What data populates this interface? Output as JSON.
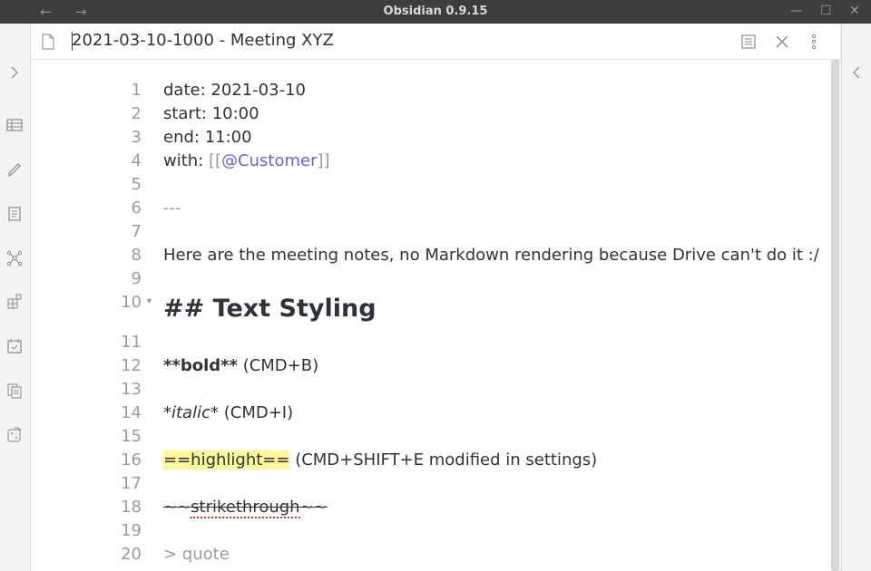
{
  "window": {
    "title": "Obsidian 0.9.15",
    "nav_back": "←",
    "nav_forward": "→",
    "minimize": "—",
    "maximize": "☐",
    "close": "✕"
  },
  "pane": {
    "title": "2021-03-10-1000 - Meeting XYZ"
  },
  "editor": {
    "lines": [
      {
        "num": "1",
        "text": "date: 2021-03-10"
      },
      {
        "num": "2",
        "text": "start: 10:00"
      },
      {
        "num": "3",
        "text": "end: 11:00"
      },
      {
        "num": "4",
        "prefix": "with: ",
        "bracket_open": "[[",
        "link": "@Customer",
        "bracket_close": "]]"
      },
      {
        "num": "5",
        "text": ""
      },
      {
        "num": "6",
        "text": "---"
      },
      {
        "num": "7",
        "text": ""
      },
      {
        "num": "8",
        "text": "Here are the meeting notes, no Markdown rendering because Drive can't do it :/"
      },
      {
        "num": "9",
        "text": ""
      },
      {
        "num": "10",
        "text": "## Text Styling",
        "fold": "▾"
      },
      {
        "num": "11",
        "text": ""
      },
      {
        "num": "12",
        "bold": "**bold**",
        "rest": " (CMD+B)"
      },
      {
        "num": "13",
        "text": ""
      },
      {
        "num": "14",
        "italic": "*italic*",
        "rest": " (CMD+I)"
      },
      {
        "num": "15",
        "text": ""
      },
      {
        "num": "16",
        "highlight": "==highlight==",
        "rest": " (CMD+SHIFT+E modified in settings)"
      },
      {
        "num": "17",
        "text": ""
      },
      {
        "num": "18",
        "strike_open": "~~",
        "strike_word": "strikethrough",
        "strike_close": "~~"
      },
      {
        "num": "19",
        "text": ""
      },
      {
        "num": "20",
        "text": "> quote"
      }
    ]
  }
}
